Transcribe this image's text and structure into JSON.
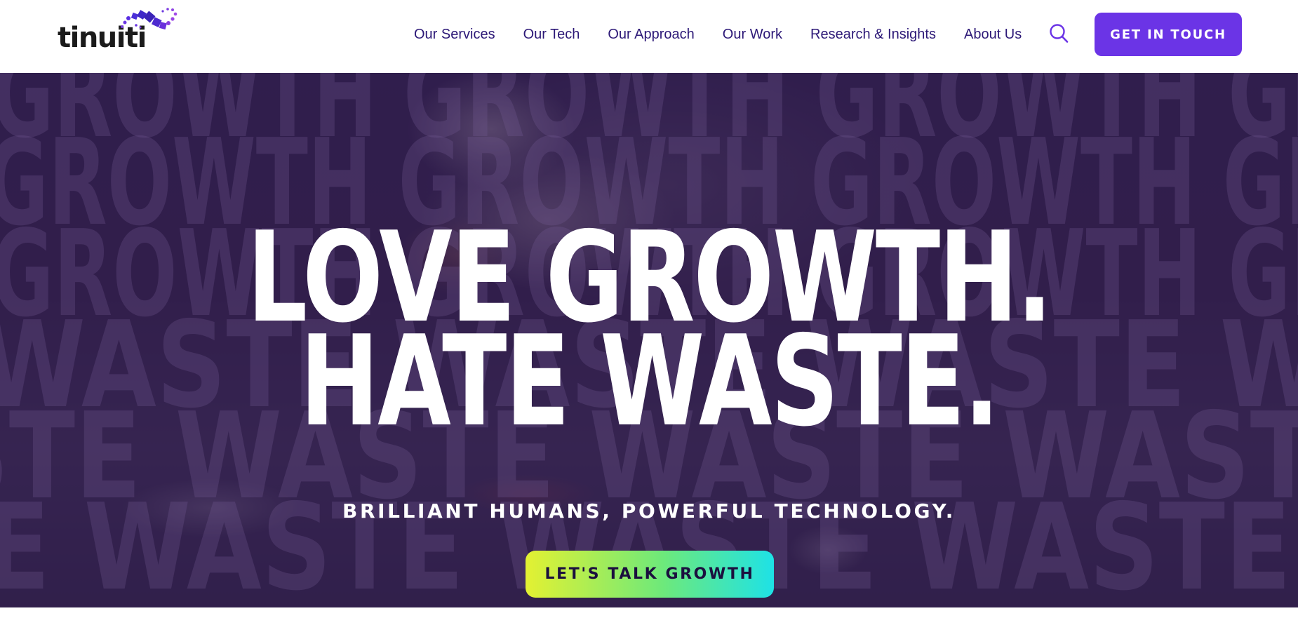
{
  "logo": {
    "text": "tinuiti"
  },
  "nav": {
    "items": [
      {
        "label": "Our Services"
      },
      {
        "label": "Our Tech"
      },
      {
        "label": "Our Approach"
      },
      {
        "label": "Our Work"
      },
      {
        "label": "Research & Insights"
      },
      {
        "label": "About Us"
      }
    ],
    "search_icon": "search-icon",
    "cta_label": "GET IN TOUCH"
  },
  "hero": {
    "background_words": [
      "GROWTH",
      "WASTE"
    ],
    "headline_line1": "LOVE GROWTH.",
    "headline_line2": "HATE WASTE.",
    "tagline": "BRILLIANT HUMANS, POWERFUL TECHNOLOGY.",
    "button_label": "LET'S TALK GROWTH"
  },
  "colors": {
    "brand_purple": "#6b34e6",
    "nav_text": "#2c1877",
    "hero_overlay": "#210a4d",
    "button_gradient_start": "#e3f132",
    "button_gradient_end": "#1ee2e6"
  }
}
